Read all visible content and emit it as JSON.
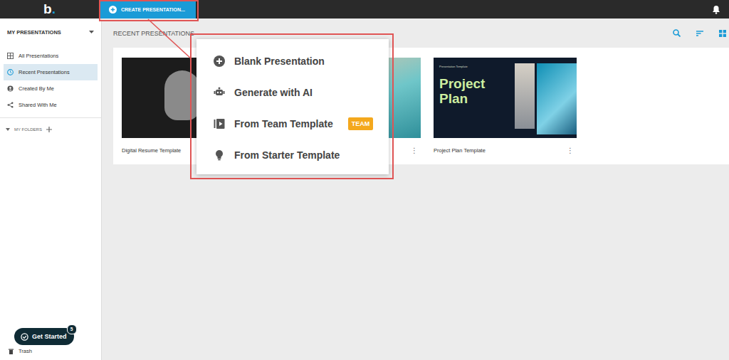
{
  "logo": {
    "letter": "b",
    "dot": "."
  },
  "top_bar": {
    "create_button": "CREATE PRESENTATION..."
  },
  "sidebar": {
    "title": "MY PRESENTATIONS",
    "items": [
      {
        "label": "All Presentations",
        "selected": false
      },
      {
        "label": "Recent Presentations",
        "selected": true
      },
      {
        "label": "Created By Me",
        "selected": false
      },
      {
        "label": "Shared With Me",
        "selected": false
      }
    ],
    "folders": "MY FOLDERS",
    "get_started": {
      "label": "Get Started",
      "count": "5"
    },
    "trash": "Trash"
  },
  "main": {
    "title": "RECENT PRESENTATIONS",
    "cards": [
      {
        "title": "Digital Resume Template",
        "menu": "⋮",
        "kind": "portrait"
      },
      {
        "title": "",
        "menu": "⋮",
        "kind": "landscape"
      },
      {
        "title": "Project Plan Template",
        "menu": "⋮",
        "kind": "slide",
        "slide_label": "Presentation Template",
        "slide_title": "Project Plan"
      }
    ]
  },
  "menu": {
    "items": [
      {
        "label": "Blank Presentation"
      },
      {
        "label": "Generate with AI"
      },
      {
        "label": "From Team Template",
        "badge": "TEAM"
      },
      {
        "label": "From Starter Template"
      }
    ]
  }
}
